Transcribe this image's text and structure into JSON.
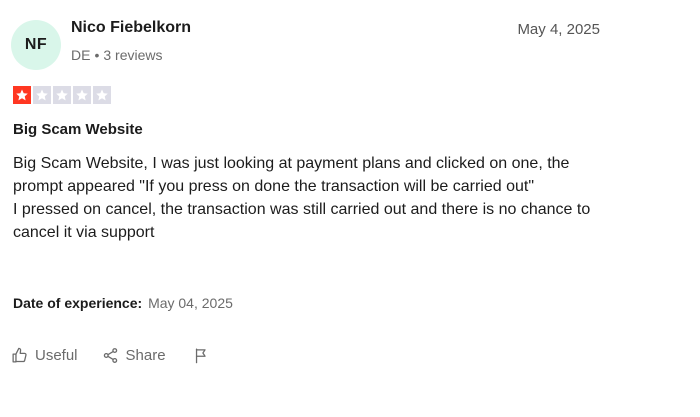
{
  "reviewer": {
    "initials": "NF",
    "name": "Nico Fiebelkorn",
    "country": "DE",
    "meta_sep": "•",
    "review_count": "3 reviews",
    "avatar_color": "#d9f6ea"
  },
  "review": {
    "date": "May 4, 2025",
    "rating": 1,
    "max_rating": 5,
    "star_color": "#ff3722",
    "title": "Big Scam Website",
    "body_lines": [
      "Big Scam Website, I was just looking at payment plans and clicked on one, the prompt appeared \"If you press on done the transaction will be carried out\"",
      "I pressed on cancel, the transaction was still carried out and there is no chance to cancel it via support"
    ],
    "experience_label": "Date of experience:",
    "experience_date": "May 04, 2025"
  },
  "actions": {
    "useful_label": "Useful",
    "useful_icon": "thumbs-up-icon",
    "share_label": "Share",
    "share_icon": "share-icon",
    "report_icon": "flag-icon"
  }
}
